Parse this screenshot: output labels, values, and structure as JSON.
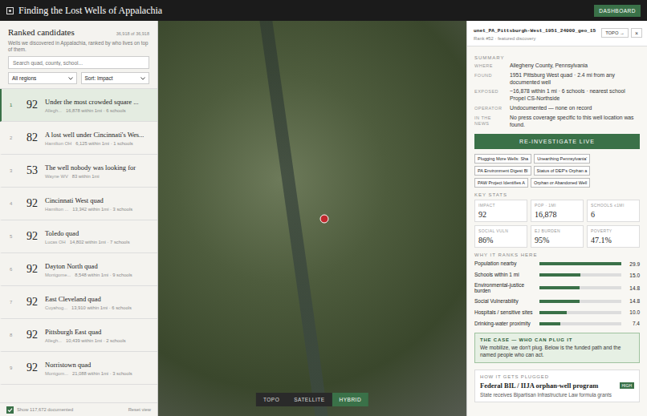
{
  "header": {
    "title": "Finding the Lost Wells of Appalachia",
    "button": "DASHBOARD"
  },
  "sidebar": {
    "title": "Ranked candidates",
    "count": "36,918 of 36,918",
    "subtitle": "Wells we discovered in Appalachia, ranked by who lives on top of them.",
    "search": {
      "placeholder": "Search quad, county, school..."
    },
    "filters": [
      "All regions",
      "Sort: Impact"
    ],
    "items": [
      {
        "rank": "1",
        "score": "92",
        "title": "Under the most crowded square ...",
        "place": "Allegh...",
        "meta": "16,878 within 1mi · 6 schools",
        "selected": true
      },
      {
        "rank": "2",
        "score": "82",
        "title": "A lost well under Cincinnati's Wes...",
        "place": "Hamilton OH",
        "meta": "6,125 within 1mi · 1 schools",
        "selected": false
      },
      {
        "rank": "3",
        "score": "53",
        "title": "The well nobody was looking for",
        "place": "Wayne WV",
        "meta": "83 within 1mi",
        "selected": false
      },
      {
        "rank": "4",
        "score": "92",
        "title": "Cincinnati West quad",
        "place": "Hamilton ...",
        "meta": "13,342 within 1mi · 3 schools",
        "selected": false
      },
      {
        "rank": "5",
        "score": "92",
        "title": "Toledo quad",
        "place": "Lucas OH",
        "meta": "14,802 within 1mi · 7 schools",
        "selected": false
      },
      {
        "rank": "6",
        "score": "92",
        "title": "Dayton North quad",
        "place": "Montgome...",
        "meta": "8,548 within 1mi · 9 schools",
        "selected": false
      },
      {
        "rank": "7",
        "score": "92",
        "title": "East Cleveland quad",
        "place": "Cuyahog...",
        "meta": "13,910 within 1mi · 6 schools",
        "selected": false
      },
      {
        "rank": "8",
        "score": "92",
        "title": "Pittsburgh East quad",
        "place": "Allegh...",
        "meta": "10,439 within 1mi · 2 schools",
        "selected": false
      },
      {
        "rank": "9",
        "score": "92",
        "title": "Norristown quad",
        "place": "Montgom...",
        "meta": "21,088 within 1mi · 3 schools",
        "selected": false
      }
    ],
    "footer": {
      "checkbox": {
        "label": "Show 117,672 documented",
        "checked": true
      },
      "reset": "Reset view"
    }
  },
  "map": {
    "view_toggle": [
      {
        "label": "TOPO",
        "selected": false
      },
      {
        "label": "SATELLITE",
        "selected": false
      },
      {
        "label": "HYBRID",
        "selected": true
      }
    ]
  },
  "detail": {
    "id": "unet_PA_Pittsburgh-West_1951_24000_geo_15",
    "rank_line": "Rank #52 · featured discovery",
    "topo_button": "TOPO →",
    "close": "×",
    "summary_title": "SUMMARY",
    "summary": [
      {
        "label": "WHERE",
        "value": "Allegheny County, Pennsylvania"
      },
      {
        "label": "FOUND",
        "value": "1951 Pittsburg West quad · 2.4 mi from any documented well"
      },
      {
        "label": "EXPOSED",
        "value": "~16,878 within 1 mi · 6 schools · nearest school Propel CS-Northside"
      },
      {
        "label": "OPERATOR",
        "value": "Undocumented — none on record"
      },
      {
        "label": "IN THE NEWS",
        "value": "No press coverage specific to this well location was found."
      }
    ],
    "action": "RE-INVESTIGATE LIVE",
    "tags": [
      "Plugging More Wells: Sha",
      "Unearthing Pennsylvania'",
      "PA Environment Digest Bl",
      "Status of DEP's Orphan a",
      "PAW Project Identifies A",
      "Orphan or Abandoned Well"
    ],
    "stats_title": "KEY STATS",
    "stats": [
      {
        "label": "IMPACT",
        "value": "92"
      },
      {
        "label": "POP · 1MI",
        "value": "16,878"
      },
      {
        "label": "SCHOOLS ≤1MI",
        "value": "6"
      },
      {
        "label": "SOCIAL VULN",
        "value": "86%"
      },
      {
        "label": "EJ BURDEN",
        "value": "95%"
      },
      {
        "label": "POVERTY",
        "value": "47.1%"
      }
    ],
    "ranks_title": "WHY IT RANKS HERE",
    "ranks": [
      {
        "label": "Population nearby",
        "value": "29.9",
        "level": 1.0
      },
      {
        "label": "Schools within 1 mi",
        "value": "15.0",
        "level": 0.5
      },
      {
        "label": "Environmental-justice burden",
        "value": "14.8",
        "level": 0.49
      },
      {
        "label": "Social Vulnerability",
        "value": "14.8",
        "level": 0.49
      },
      {
        "label": "Hospitals / sensitive sites",
        "value": "10.0",
        "level": 0.33
      },
      {
        "label": "Drinking-water proximity",
        "value": "7.4",
        "level": 0.25
      }
    ],
    "case": {
      "title": "THE CASE — WHO CAN PLUG IT",
      "text": "We mobilize, we don't plug. Below is the funded path and the named people who can act."
    },
    "plug": {
      "title": "HOW IT GETS PLUGGED",
      "name": "Federal BIL / IIJA orphan-well program",
      "badge": "HIGH",
      "text": "State receives Bipartisan Infrastructure Law formula grants"
    }
  }
}
